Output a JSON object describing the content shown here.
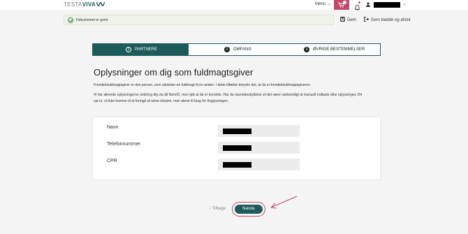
{
  "header": {
    "logo_part1": "TESTA",
    "logo_part2": "VIVA",
    "menu_label": "Menu",
    "cart_count": "0"
  },
  "toast": {
    "message": "Dokumentet er gemt"
  },
  "toolbar": {
    "save_label": "Gem",
    "save_close_label": "Gem kladde og afslut"
  },
  "stepper": {
    "steps": [
      {
        "number": "1",
        "label": "PARTNERE"
      },
      {
        "number": "2",
        "label": "OMFANG"
      },
      {
        "number": "3",
        "label": "ØVRIGE BESTEMMELSER"
      }
    ],
    "active_index": 0
  },
  "main": {
    "title": "Oplysninger om dig som fuldmagtsgiver",
    "paragraph1": "Fremtidsfuldmagtsgiver er den person, som udsteder en fuldmagt til en anden. I dette tilfælde betyder det, at du er fremtidsfuldmagtsgiveren.",
    "paragraph2": "Vi har allerede oplysningerne omkring dig via dit NemID, men tjek at de er korrekte. Har du navnebeskyttelse vil det være nødvendigt at manuelt indtaste dine oplysninger. Dit cpr.nr. vil ikke komme til at fremgå af selve teksten, men alene til brug for tinglysningen."
  },
  "form": {
    "fields": [
      {
        "label": "Navn"
      },
      {
        "label": "Telefonnummer"
      },
      {
        "label": "CPR"
      }
    ]
  },
  "nav": {
    "back_label": "Tilbage",
    "next_label": "Næste"
  },
  "colors": {
    "primary": "#1d5a5a",
    "accent": "#c2496c",
    "success": "#3d8a55"
  }
}
